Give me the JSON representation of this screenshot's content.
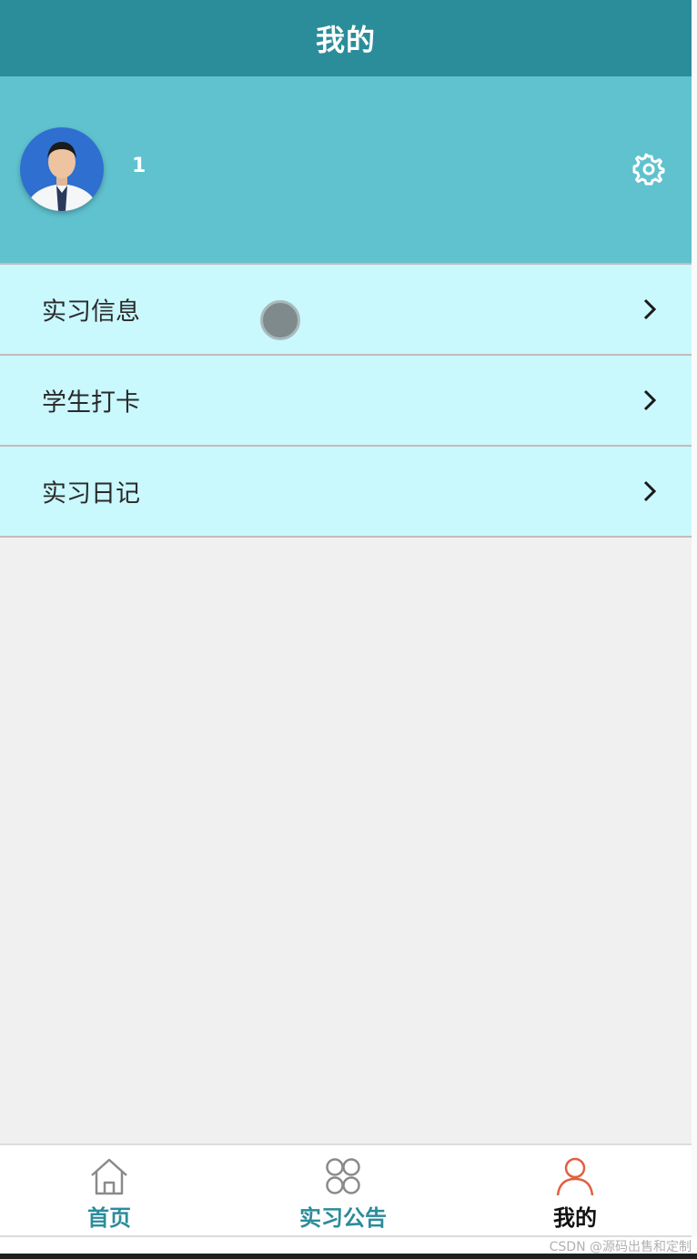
{
  "header": {
    "title": "我的"
  },
  "profile": {
    "username": "1",
    "avatar_icon": "user-avatar-photo",
    "settings_icon": "gear-icon"
  },
  "menu": {
    "items": [
      {
        "label": "实习信息",
        "icon": "chevron-right-icon"
      },
      {
        "label": "学生打卡",
        "icon": "chevron-right-icon"
      },
      {
        "label": "实习日记",
        "icon": "chevron-right-icon"
      }
    ]
  },
  "tabbar": {
    "tabs": [
      {
        "label": "首页",
        "icon": "home-icon",
        "active": false
      },
      {
        "label": "实习公告",
        "icon": "grid-clover-icon",
        "active": false
      },
      {
        "label": "我的",
        "icon": "person-icon",
        "active": true
      }
    ]
  },
  "watermark": "CSDN @源码出售和定制",
  "colors": {
    "header_bg": "#2b8c9a",
    "profile_bg": "#5fc2ce",
    "menu_bg": "#c9f8fd",
    "tab_label": "#2b8c9a",
    "active_icon": "#e06040"
  }
}
